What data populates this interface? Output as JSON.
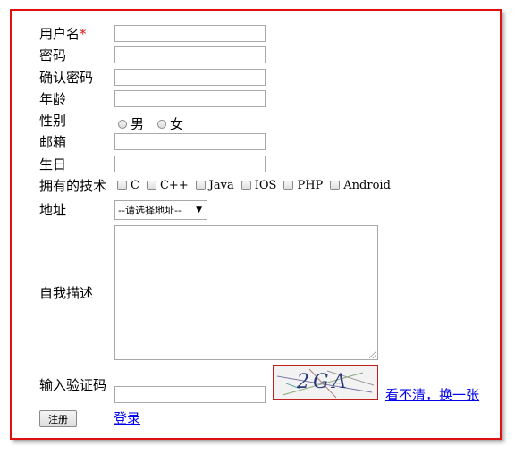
{
  "form": {
    "username_label": "用户名",
    "required_mark": "*",
    "password_label": "密码",
    "confirm_password_label": "确认密码",
    "age_label": "年龄",
    "gender_label": "性别",
    "gender_options": [
      "男",
      "女"
    ],
    "email_label": "邮箱",
    "birthday_label": "生日",
    "skills_label": "拥有的技术",
    "skills_options": [
      "C",
      "C++",
      "Java",
      "IOS",
      "PHP",
      "Android"
    ],
    "address_label": "地址",
    "address_select_value": "--请选择地址--",
    "description_label": "自我描述",
    "captcha_label": "输入验证码",
    "captcha_text": "2GA",
    "refresh_captcha_link": "看不清，换一张",
    "register_button": "注册",
    "login_link": "登录"
  },
  "colors": {
    "frame_border": "#e01010",
    "link": "#0000ee",
    "required": "#e01010"
  }
}
